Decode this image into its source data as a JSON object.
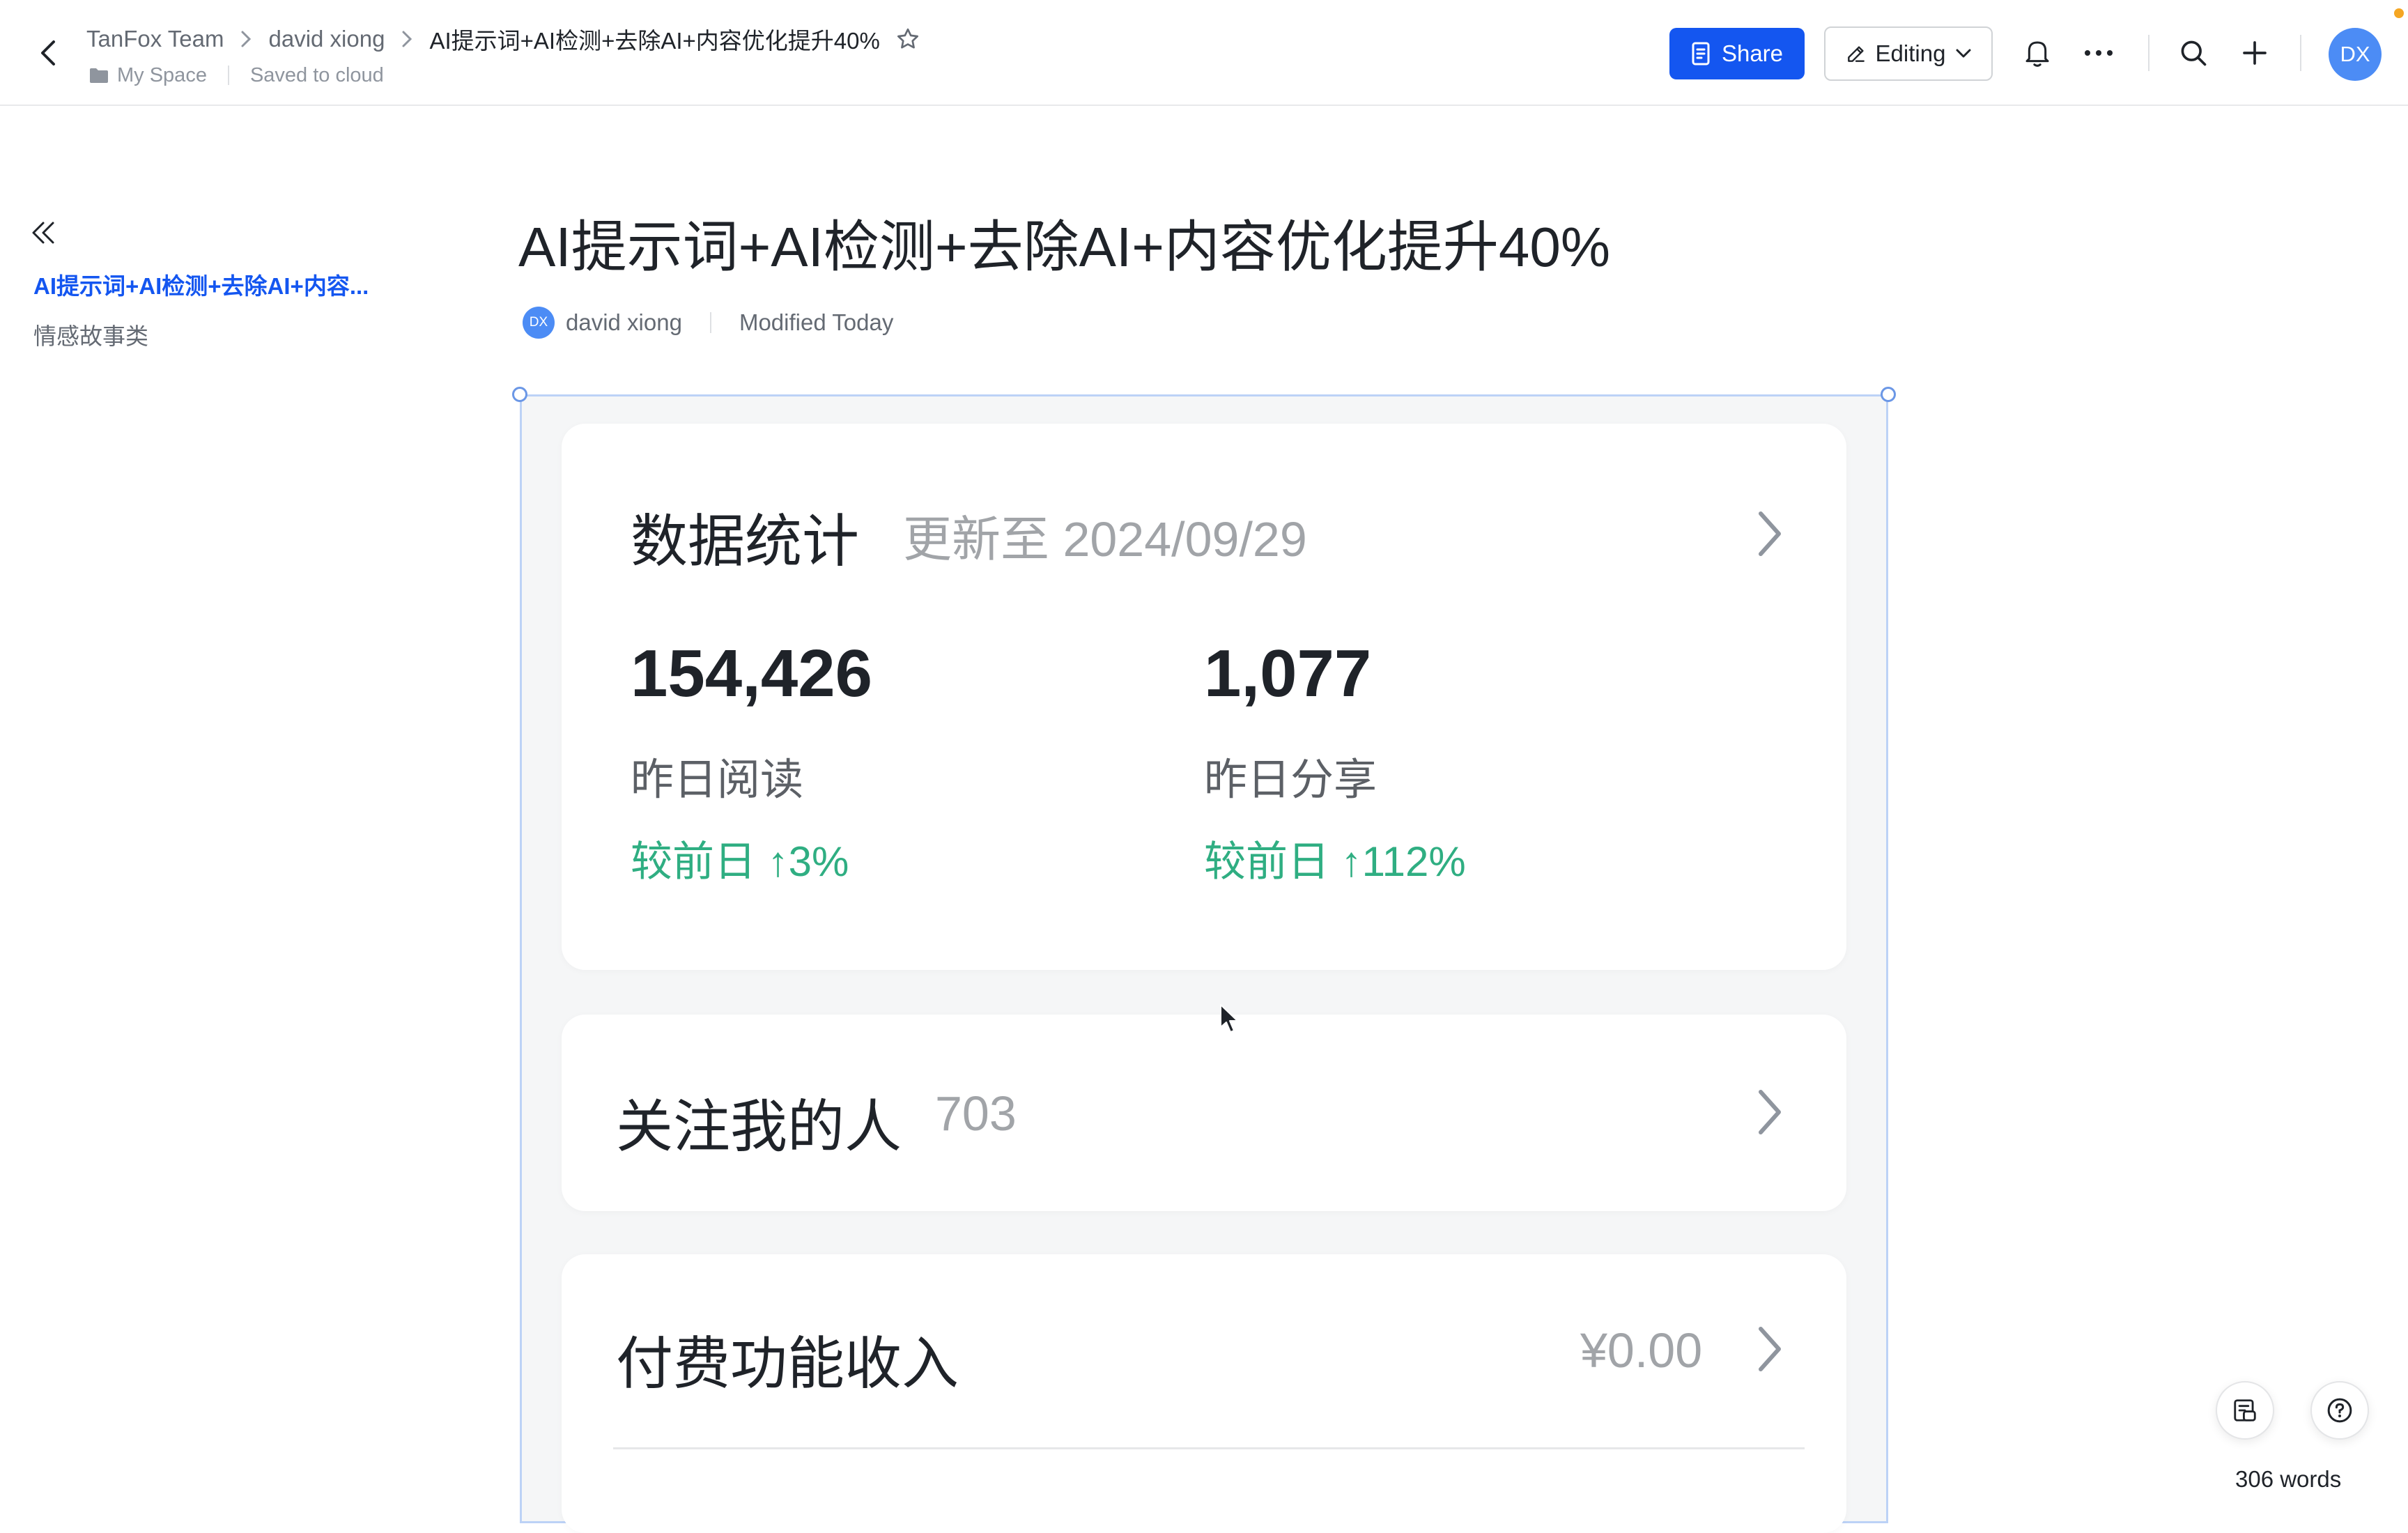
{
  "header": {
    "breadcrumbs": [
      "TanFox Team",
      "david xiong",
      "AI提示词+AI检测+去除AI+内容优化提升40%"
    ],
    "location": "My Space",
    "save_status": "Saved to cloud",
    "share_label": "Share",
    "editing_label": "Editing",
    "avatar_initials": "DX"
  },
  "outline": {
    "items": [
      "AI提示词+AI检测+去除AI+内容...",
      "情感故事类"
    ]
  },
  "doc": {
    "title": "AI提示词+AI检测+去除AI+内容优化提升40%",
    "author_initials": "DX",
    "author": "david xiong",
    "modified": "Modified Today"
  },
  "stats_card": {
    "title": "数据统计",
    "updated": "更新至 2024/09/29",
    "metrics": [
      {
        "value": "154,426",
        "label": "昨日阅读",
        "change": "较前日 ↑3%"
      },
      {
        "value": "1,077",
        "label": "昨日分享",
        "change": "较前日 ↑112%"
      }
    ]
  },
  "followers_card": {
    "title": "关注我的人",
    "count": "703"
  },
  "income_card": {
    "title": "付费功能收入",
    "amount": "¥0.00"
  },
  "footer": {
    "word_count": "306 words"
  },
  "colors": {
    "accent": "#1456f0",
    "positive": "#2fae82",
    "avatar": "#4c8cf5"
  }
}
